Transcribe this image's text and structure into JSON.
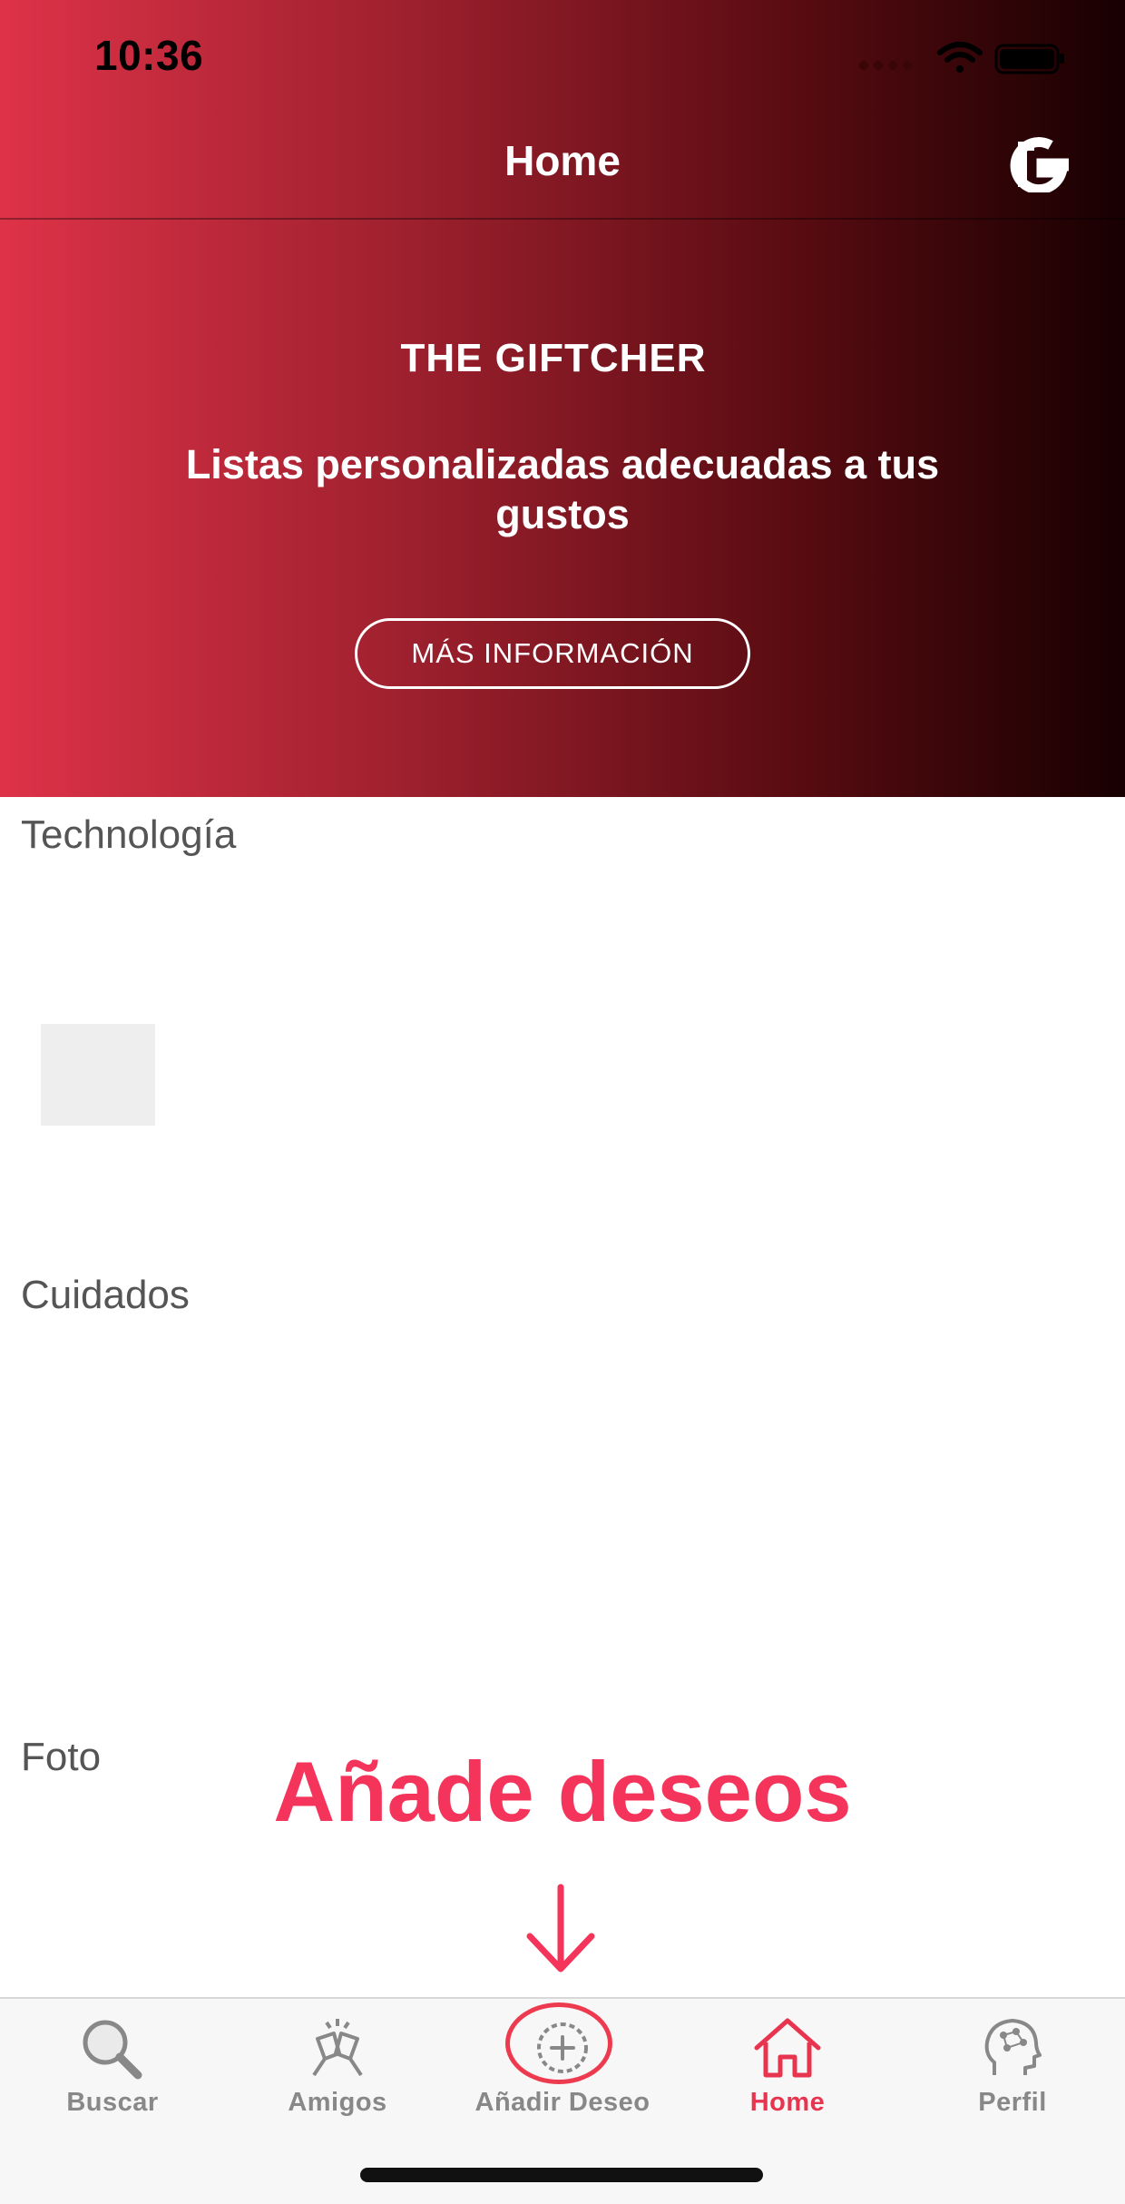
{
  "status_bar": {
    "time": "10:36"
  },
  "nav": {
    "title": "Home"
  },
  "hero": {
    "title": "THE GIFTCHER",
    "subtitle": "Listas personalizadas adecuadas a tus gustos",
    "button_label": "MÁS INFORMACIÓN"
  },
  "sections": [
    {
      "title": "Technología"
    },
    {
      "title": "Cuidados"
    },
    {
      "title": "Foto"
    }
  ],
  "annotation": {
    "text": "Añade deseos"
  },
  "tabbar": {
    "items": [
      {
        "label": "Buscar",
        "icon": "search-icon"
      },
      {
        "label": "Amigos",
        "icon": "cheers-icon"
      },
      {
        "label": "Añadir Deseo",
        "icon": "add-circle-icon"
      },
      {
        "label": "Home",
        "icon": "home-icon"
      },
      {
        "label": "Perfil",
        "icon": "brain-head-icon"
      }
    ],
    "active_index": 3
  },
  "colors": {
    "accent": "#e8344f",
    "annotation": "#f4345a",
    "hero_gradient_start": "#de3248",
    "hero_gradient_end": "#180001"
  }
}
